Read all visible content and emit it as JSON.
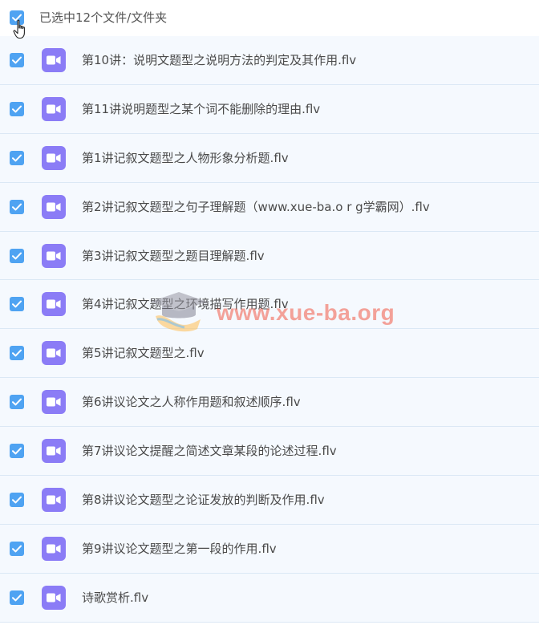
{
  "header": {
    "label": "已选中12个文件/文件夹",
    "checked": true
  },
  "files": [
    {
      "name": "第10讲：说明文题型之说明方法的判定及其作用.flv",
      "checked": true,
      "icon": "video-icon"
    },
    {
      "name": "第11讲说明题型之某个词不能删除的理由.flv",
      "checked": true,
      "icon": "video-icon"
    },
    {
      "name": "第1讲记叙文题型之人物形象分析题.flv",
      "checked": true,
      "icon": "video-icon"
    },
    {
      "name": "第2讲记叙文题型之句子理解题（www.xue-ba.o r g学霸网）.flv",
      "checked": true,
      "icon": "video-icon"
    },
    {
      "name": "第3讲记叙文题型之题目理解题.flv",
      "checked": true,
      "icon": "video-icon"
    },
    {
      "name": "第4讲记叙文题型之环境描写作用题.flv",
      "checked": true,
      "icon": "video-icon"
    },
    {
      "name": "第5讲记叙文题型之.flv",
      "checked": true,
      "icon": "video-icon"
    },
    {
      "name": "第6讲议论文之人称作用题和叙述顺序.flv",
      "checked": true,
      "icon": "video-icon"
    },
    {
      "name": "第7讲议论文提醒之简述文章某段的论述过程.flv",
      "checked": true,
      "icon": "video-icon"
    },
    {
      "name": "第8讲议论文题型之论证发放的判断及作用.flv",
      "checked": true,
      "icon": "video-icon"
    },
    {
      "name": "第9讲议论文题型之第一段的作用.flv",
      "checked": true,
      "icon": "video-icon"
    },
    {
      "name": "诗歌赏析.flv",
      "checked": true,
      "icon": "video-icon"
    }
  ],
  "watermark": {
    "text": "www.xue-ba.org"
  },
  "colors": {
    "checkbox": "#4fa3f2",
    "file_icon": "#8b7cf6",
    "row_background": "#f5f9fe",
    "row_border": "#dbe8f5"
  }
}
